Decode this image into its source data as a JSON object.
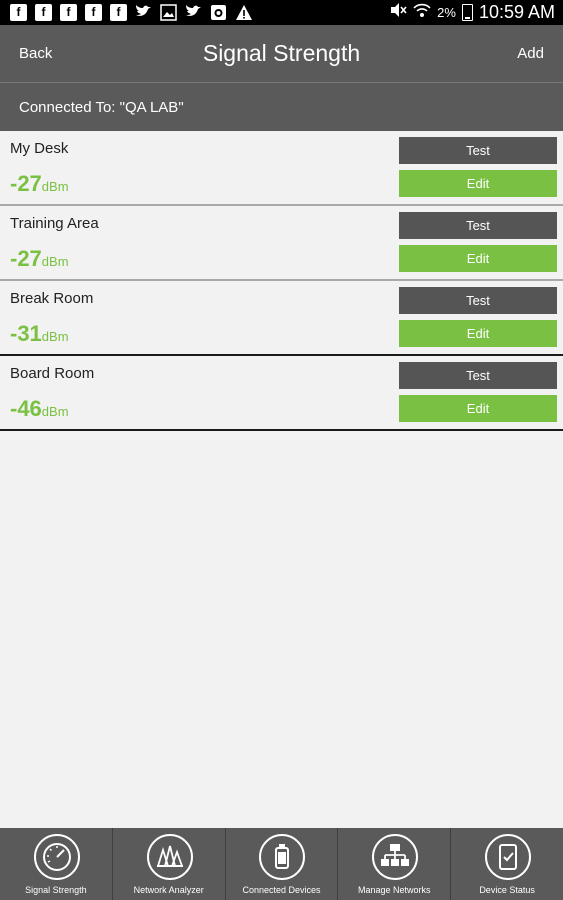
{
  "status_bar": {
    "battery": "2%",
    "time": "10:59 AM",
    "notification_icons": [
      "facebook-icon",
      "facebook-icon",
      "facebook-icon",
      "facebook-icon",
      "facebook-icon",
      "twitter-icon",
      "image-icon",
      "twitter-icon",
      "camera-icon",
      "warning-icon"
    ]
  },
  "header": {
    "back_label": "Back",
    "title": "Signal Strength",
    "add_label": "Add"
  },
  "connection": {
    "text": "Connected To: \"QA LAB\""
  },
  "locations": [
    {
      "name": "My Desk",
      "value": "-27",
      "unit": "dBm",
      "test_label": "Test",
      "edit_label": "Edit"
    },
    {
      "name": "Training Area",
      "value": "-27",
      "unit": "dBm",
      "test_label": "Test",
      "edit_label": "Edit"
    },
    {
      "name": "Break Room",
      "value": "-31",
      "unit": "dBm",
      "test_label": "Test",
      "edit_label": "Edit"
    },
    {
      "name": "Board Room",
      "value": "-46",
      "unit": "dBm",
      "test_label": "Test",
      "edit_label": "Edit"
    }
  ],
  "tabs": [
    {
      "label": "Signal Strength",
      "icon": "gauge-icon"
    },
    {
      "label": "Network Analyzer",
      "icon": "spectrum-icon"
    },
    {
      "label": "Connected Devices",
      "icon": "device-icon"
    },
    {
      "label": "Manage Networks",
      "icon": "network-icon"
    },
    {
      "label": "Device Status",
      "icon": "tablet-check-icon"
    }
  ],
  "colors": {
    "accent_green": "#7ac143",
    "bar_gray": "#5a5a5a",
    "button_gray": "#555555",
    "background": "#f2f2f2"
  }
}
